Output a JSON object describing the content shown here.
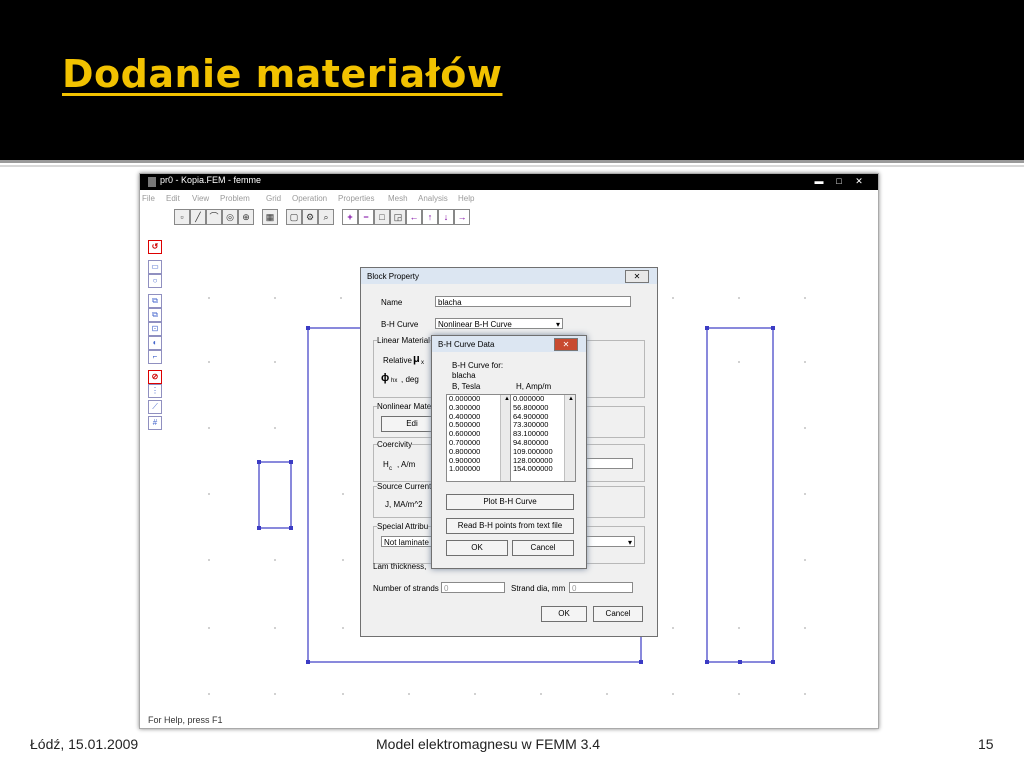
{
  "slide": {
    "title": "Dodanie materiałów",
    "footer_left": "Łódź, 15.01.2009",
    "footer_center": "Model elektromagnesu w FEMM 3.4",
    "footer_right": "15"
  },
  "app": {
    "window_title": "pr0 - Kopia.FEM - femme",
    "menu": [
      "File",
      "Edit",
      "View",
      "Problem",
      "Grid",
      "Operation",
      "Properties",
      "Mesh",
      "Analysis",
      "Help"
    ],
    "status": "For Help, press F1",
    "controls": {
      "minimize": "▬",
      "maximize": "□",
      "close": "✕"
    }
  },
  "block_property": {
    "title": "Block Property",
    "close": "✕",
    "name_label": "Name",
    "name_value": "blacha",
    "bh_label": "B-H Curve",
    "bh_value": "Nonlinear B-H Curve",
    "linear_group": "Linear Material",
    "relative_label": "Relative",
    "mu_symbol": "μ",
    "mu_sub": "x",
    "phi_symbol": "ϕ",
    "phi_sub": "hx",
    "phi_unit": ", deg",
    "nonlinear_group": "Nonlinear Mate",
    "edit_button": "Edi",
    "coercivity_group": "Coercivity",
    "hc_h": "H",
    "hc_sub": "c",
    "hc_unit": ", A/m",
    "source_group": "Source Current",
    "source_label": "J, MA/m^2",
    "special_group": "Special Attribu",
    "lam_value": "Not laminate",
    "lam_thickness": "Lam thickness,",
    "strands_label": "Number of strands",
    "strands_value": "0",
    "strand_dia_label": "Strand dia, mm",
    "strand_dia_value": "0",
    "ok": "OK",
    "cancel": "Cancel"
  },
  "bh_dialog": {
    "title": "B-H Curve Data",
    "close": "✕",
    "for_label": "B-H Curve for:",
    "material": "blacha",
    "col_b": "B, Tesla",
    "col_h": "H, Amp/m",
    "b_values": [
      "0.000000",
      "0.300000",
      "0.400000",
      "0.500000",
      "0.600000",
      "0.700000",
      "0.800000",
      "0.900000",
      "1.000000"
    ],
    "h_values": [
      "0.000000",
      "56.800000",
      "64.900000",
      "73.300000",
      "83.100000",
      "94.800000",
      "109.000000",
      "128.000000",
      "154.000000"
    ],
    "plot_button": "Plot B-H Curve",
    "read_button": "Read B-H points from text file",
    "ok": "OK",
    "cancel": "Cancel"
  }
}
